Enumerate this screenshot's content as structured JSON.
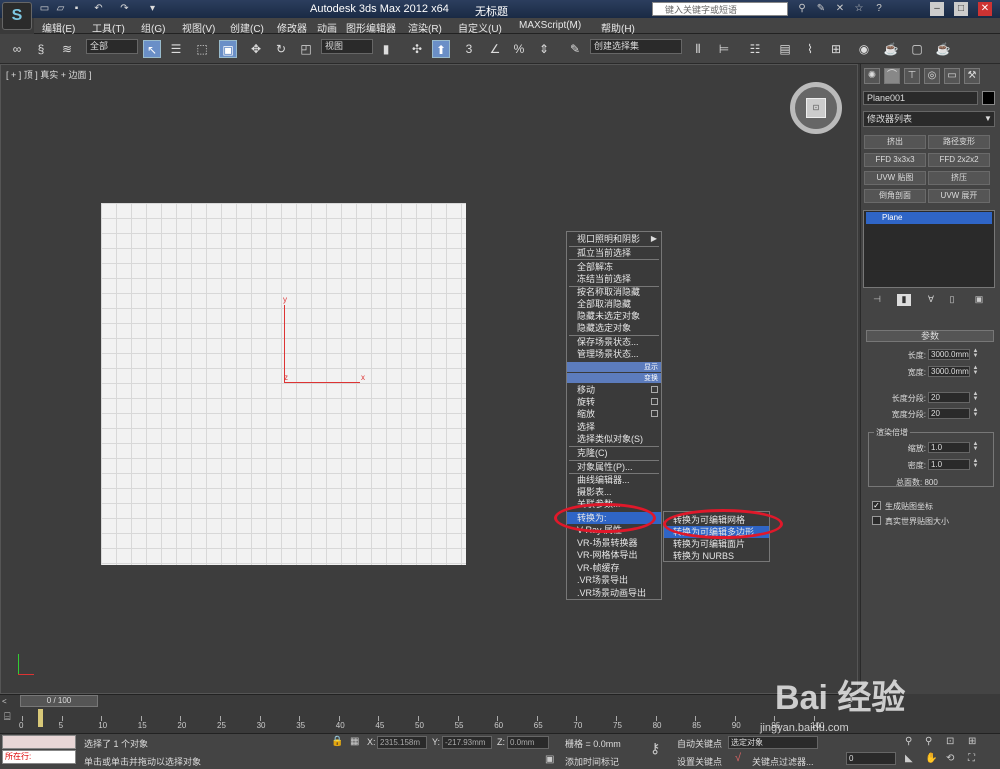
{
  "titlebar": {
    "app_title": "Autodesk 3ds Max  2012 x64",
    "doc_title": "无标题",
    "search_placeholder": "键入关键字或短语"
  },
  "menu": [
    "编辑(E)",
    "工具(T)",
    "组(G)",
    "视图(V)",
    "创建(C)",
    "修改器",
    "动画",
    "图形编辑器",
    "渲染(R)",
    "自定义(U)",
    "MAXScript(M)",
    "帮助(H)"
  ],
  "toolbar": {
    "selection_filter": "全部",
    "ref_coord": "视图",
    "named_selection": "创建选择集"
  },
  "viewport": {
    "label": "[ + ] 顶 ] 真实 + 边面 ]",
    "axis_y": "y",
    "axis_x": "x",
    "axis_z": "z"
  },
  "quad_menu": {
    "items": [
      "视口照明和阴影",
      "孤立当前选择",
      "全部解冻",
      "冻结当前选择",
      "按名称取消隐藏",
      "全部取消隐藏",
      "隐藏未选定对象",
      "隐藏选定对象",
      "保存场景状态...",
      "管理场景状态...",
      "移动",
      "旋转",
      "缩放",
      "选择",
      "选择类似对象(S)",
      "克隆(C)",
      "对象属性(P)...",
      "曲线编辑器...",
      "摄影表...",
      "关联参数...",
      "转换为:",
      "V-Ray 属性",
      "VR-场景转换器",
      "VR-网格体导出",
      "VR-帧缓存",
      ".VR场景导出",
      ".VR场景动画导出"
    ],
    "header_display": "显示",
    "header_transform": "变换",
    "submenu": [
      "转换为可编辑网格",
      "转换为可编辑多边形",
      "转换为可编辑面片",
      "转换为 NURBS"
    ]
  },
  "panel": {
    "object_name": "Plane001",
    "modifier_list": "修改器列表",
    "mod_buttons": [
      "挤出",
      "路径变形",
      "FFD 3x3x3",
      "FFD 2x2x2",
      "UVW 贴图",
      "挤压",
      "倒角剖面",
      "UVW 展开"
    ],
    "stack_item": "Plane",
    "rollout_title": "参数",
    "length_label": "长度:",
    "length_value": "3000.0mm",
    "width_label": "宽度:",
    "width_value": "3000.0mm",
    "lsegs_label": "长度分段:",
    "lsegs_value": "20",
    "wsegs_label": "宽度分段:",
    "wsegs_value": "20",
    "render_mult": "渲染倍增",
    "scale_label": "缩放:",
    "scale_value": "1.0",
    "density_label": "密度:",
    "density_value": "1.0",
    "total_faces": "总面数: 800",
    "gen_map_coords": "生成贴图坐标",
    "real_world": "真实世界贴图大小"
  },
  "timeline": {
    "slider": "0 / 100",
    "ticks": [
      "0",
      "5",
      "10",
      "15",
      "20",
      "25",
      "30",
      "35",
      "40",
      "45",
      "50",
      "55",
      "60",
      "65",
      "70",
      "75",
      "80",
      "85",
      "90",
      "95",
      "100"
    ]
  },
  "status": {
    "listener_text": "所在行:",
    "prompt1": "选择了 1 个对象",
    "prompt2": "单击或单击并拖动以选择对象",
    "x_label": "X:",
    "x_value": "2315.158m",
    "y_label": "Y:",
    "y_value": "-217.93mm",
    "z_label": "Z:",
    "z_value": "0.0mm",
    "grid": "栅格 = 0.0mm",
    "add_time_tag": "添加时间标记",
    "auto_key": "自动关键点",
    "auto_key_dropdown": "选定对象",
    "set_key": "设置关键点",
    "key_filters": "关键点过滤器...",
    "frame": "0"
  },
  "watermark": {
    "logo": "Bai 经验",
    "url": "jingyan.baidu.com"
  }
}
